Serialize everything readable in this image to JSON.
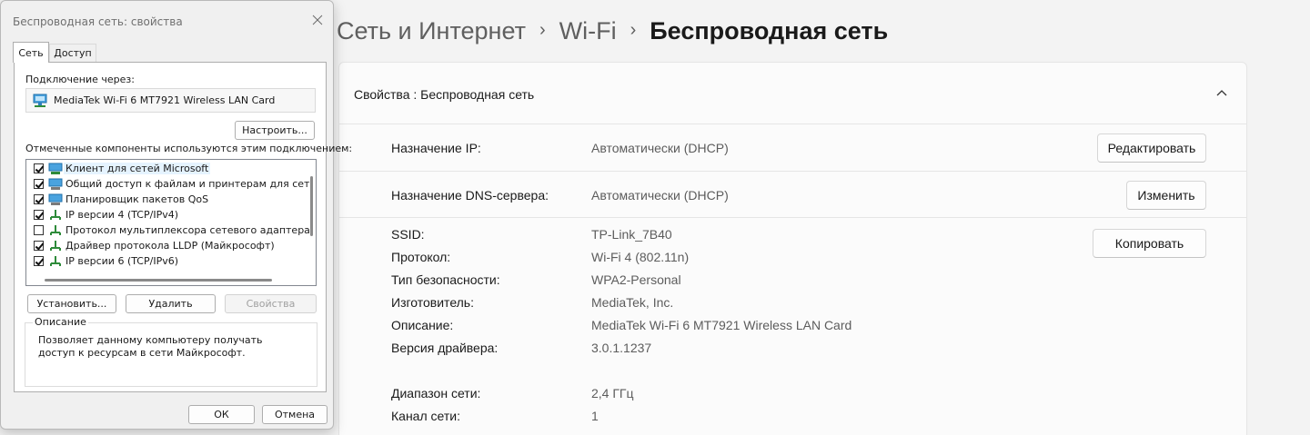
{
  "breadcrumb": {
    "item1": "Сеть и Интернет",
    "item2": "Wi-Fi",
    "current": "Беспроводная сеть",
    "separator": "›"
  },
  "card": {
    "title": "Свойства : Беспроводная сеть",
    "ip": {
      "label": "Назначение IP:",
      "value": "Автоматически (DHCP)",
      "button": "Редактировать"
    },
    "dns": {
      "label": "Назначение DNS-сервера:",
      "value": "Автоматически (DHCP)",
      "button": "Изменить"
    },
    "copy_button": "Копировать",
    "details": [
      {
        "label": "SSID:",
        "value": "TP-Link_7B40"
      },
      {
        "label": "Протокол:",
        "value": "Wi-Fi 4 (802.11n)"
      },
      {
        "label": "Тип безопасности:",
        "value": "WPA2-Personal"
      },
      {
        "label": "Изготовитель:",
        "value": "MediaTek, Inc."
      },
      {
        "label": "Описание:",
        "value": "MediaTek Wi-Fi 6 MT7921 Wireless LAN Card"
      },
      {
        "label": "Версия драйвера:",
        "value": "3.0.1.1237"
      },
      {
        "label": "Диапазон сети:",
        "value": "2,4 ГГц"
      },
      {
        "label": "Канал сети:",
        "value": "1"
      }
    ]
  },
  "dialog": {
    "title": "Беспроводная сеть: свойства",
    "tabs": [
      "Сеть",
      "Доступ"
    ],
    "connect_via_label": "Подключение через:",
    "adapter_name": "MediaTek Wi-Fi 6 MT7921 Wireless LAN Card",
    "configure_button": "Настроить...",
    "components_label": "Отмеченные компоненты используются этим подключением:",
    "components": [
      {
        "label": "Клиент для сетей Microsoft",
        "checked": true,
        "icon": "network-client-icon"
      },
      {
        "label": "Общий доступ к файлам и принтерам для сетей Mi",
        "checked": true,
        "icon": "network-service-icon"
      },
      {
        "label": "Планировщик пакетов QoS",
        "checked": true,
        "icon": "network-service-icon"
      },
      {
        "label": "IP версии 4 (TCP/IPv4)",
        "checked": true,
        "icon": "protocol-icon"
      },
      {
        "label": "Протокол мультиплексора сетевого адаптера (Май",
        "checked": false,
        "icon": "protocol-icon"
      },
      {
        "label": "Драйвер протокола LLDP (Майкрософт)",
        "checked": true,
        "icon": "protocol-icon"
      },
      {
        "label": "IP версии 6 (TCP/IPv6)",
        "checked": true,
        "icon": "protocol-icon"
      }
    ],
    "install_button": "Установить...",
    "remove_button": "Удалить",
    "properties_button": "Свойства",
    "description_legend": "Описание",
    "description_text": "Позволяет данному компьютеру получать доступ к ресурсам в сети Майкрософт.",
    "ok_button": "ОК",
    "cancel_button": "Отмена"
  }
}
